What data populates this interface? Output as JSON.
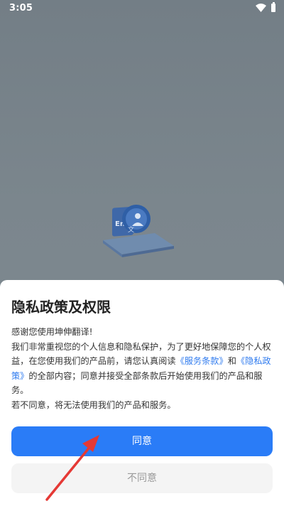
{
  "status_bar": {
    "time": "3:05",
    "wifi_icon": "wifi-icon",
    "battery_icon": "battery-icon"
  },
  "splash": {
    "logo_text": "En",
    "logo_subtext": "文",
    "logo_icon": "translate-app-logo"
  },
  "dialog": {
    "title": "隐私政策及权限",
    "greeting": "感谢您使用坤伸翻译!",
    "body_part1": "我们非常重视您的个人信息和隐私保护，为了更好地保障您的个人权益，在您使用我们的产品前，请您认真阅读",
    "terms_link": "《服务条款》",
    "and_text": "和",
    "privacy_link": "《隐私政策》",
    "body_part2": "的全部内容；同意并接受全部条款后开始使用我们的产品和服务。",
    "decline_note": "若不同意，将无法使用我们的产品和服务。",
    "agree_label": "同意",
    "disagree_label": "不同意"
  },
  "colors": {
    "accent": "#2a7cf7",
    "link": "#2f7bef",
    "overlay": "#7a858c",
    "annotation_arrow": "#e53935"
  }
}
